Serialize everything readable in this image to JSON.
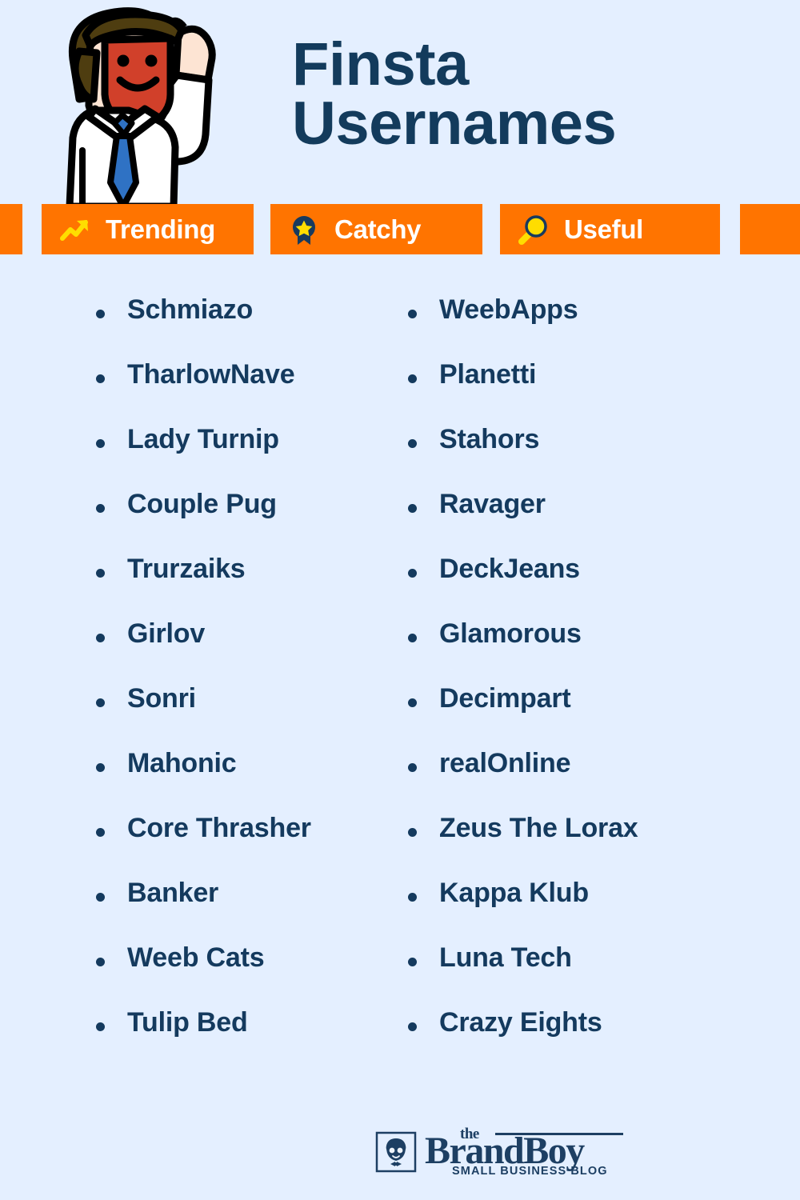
{
  "background_color": "#e4efff",
  "accent_color": "#ff7400",
  "text_color": "#143a5e",
  "header": {
    "title_line_1": "Finsta",
    "title_line_2": "Usernames",
    "mascot_alt": "waving-businessman-mascot"
  },
  "badges": [
    {
      "icon": "trending-arrow-icon",
      "label": "Trending"
    },
    {
      "icon": "award-ribbon-star-icon",
      "label": "Catchy"
    },
    {
      "icon": "magnifying-glass-icon",
      "label": "Useful"
    }
  ],
  "columns": {
    "left": [
      "Schmiazo",
      "TharlowNave",
      "Lady Turnip",
      "Couple Pug",
      "Trurzaiks",
      "Girlov",
      "Sonri",
      "Mahonic",
      "Core Thrasher",
      "Banker",
      "Weeb Cats",
      "Tulip Bed"
    ],
    "right": [
      "WeebApps",
      "Planetti",
      "Stahors",
      "Ravager",
      "DeckJeans",
      "Glamorous",
      "Decimpart",
      "realOnline",
      "Zeus The Lorax",
      "Kappa Klub",
      "Luna Tech",
      "Crazy Eights"
    ]
  },
  "footer": {
    "logo_the": "the",
    "logo_name": "BrandBoy",
    "logo_tagline": "SMALL BUSINESS BLOG",
    "logo_mark": "boy-face-glasses-bowtie-icon"
  }
}
